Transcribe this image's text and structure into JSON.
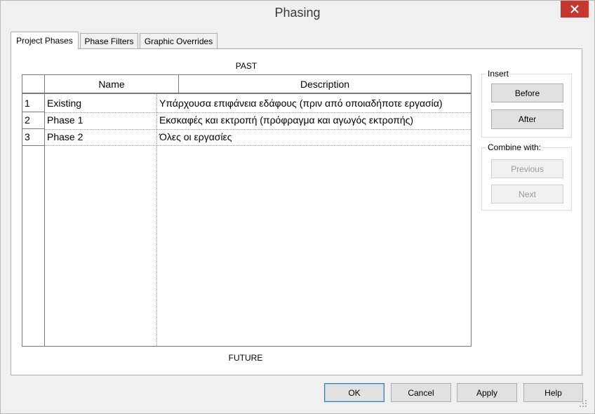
{
  "window": {
    "title": "Phasing"
  },
  "tabs": [
    {
      "label": "Project Phases"
    },
    {
      "label": "Phase Filters"
    },
    {
      "label": "Graphic Overrides"
    }
  ],
  "labels": {
    "past": "PAST",
    "future": "FUTURE"
  },
  "table": {
    "columns": [
      "Name",
      "Description"
    ],
    "rows": [
      {
        "num": "1",
        "name": "Existing",
        "description": "Υπάρχουσα επιφάνεια εδάφους (πριν από οποιαδήποτε εργασία)"
      },
      {
        "num": "2",
        "name": "Phase 1",
        "description": "Εκσκαφές και εκτροπή (πρόφραγμα και αγωγός εκτροπής)"
      },
      {
        "num": "3",
        "name": "Phase 2",
        "description": "Όλες οι εργασίες"
      }
    ]
  },
  "insert": {
    "label": "Insert",
    "before": "Before",
    "after": "After"
  },
  "combine": {
    "label": "Combine with:",
    "previous": "Previous",
    "next": "Next"
  },
  "footer": {
    "ok": "OK",
    "cancel": "Cancel",
    "apply": "Apply",
    "help": "Help"
  },
  "colors": {
    "close": "#c7372f",
    "default_border": "#3c7fb1"
  }
}
